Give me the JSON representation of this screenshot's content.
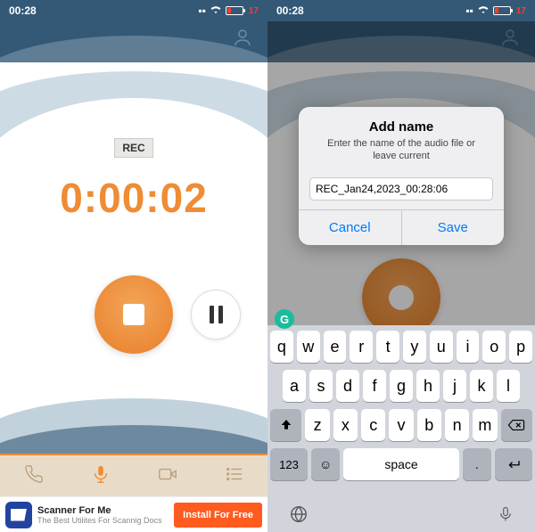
{
  "status": {
    "time": "00:28",
    "battery_pct": "17"
  },
  "left": {
    "rec_label": "REC",
    "timer": "0:00:02",
    "ad": {
      "title": "Scanner For Me",
      "subtitle": "The Best Utilites For Scannig Docs",
      "cta": "Install For Free"
    }
  },
  "right": {
    "alert": {
      "title": "Add name",
      "subtitle": "Enter the name of the audio file or leave current",
      "value": "REC_Jan24,2023_00:28:06",
      "cancel": "Cancel",
      "save": "Save"
    },
    "keyboard": {
      "row1": [
        "q",
        "w",
        "e",
        "r",
        "t",
        "y",
        "u",
        "i",
        "o",
        "p"
      ],
      "row2": [
        "a",
        "s",
        "d",
        "f",
        "g",
        "h",
        "j",
        "k",
        "l"
      ],
      "row3": [
        "z",
        "x",
        "c",
        "v",
        "b",
        "n",
        "m"
      ],
      "numkey": "123",
      "space": "space"
    }
  }
}
